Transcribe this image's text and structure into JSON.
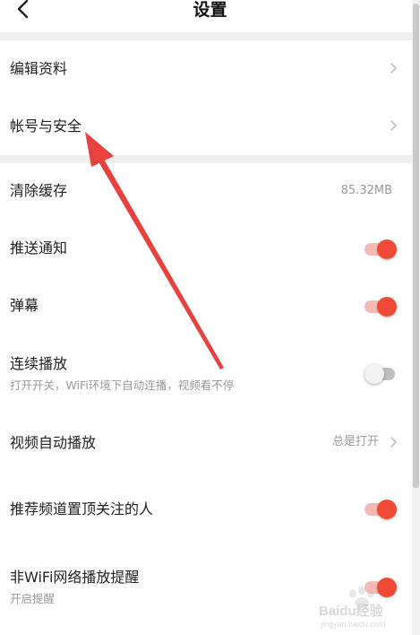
{
  "header": {
    "title": "设置",
    "back_icon": "chevron-left-icon"
  },
  "rows": {
    "edit_profile": {
      "label": "编辑资料"
    },
    "account_security": {
      "label": "帐号与安全"
    },
    "clear_cache": {
      "label": "清除缓存",
      "value": "85.32MB"
    },
    "push_notify": {
      "label": "推送通知",
      "on": true
    },
    "danmaku": {
      "label": "弹幕",
      "on": true
    },
    "continuous_play": {
      "label": "连续播放",
      "sub": "打开开关，WiFi环境下自动连播，视频看不停",
      "on": false
    },
    "video_autoplay": {
      "label": "视频自动播放",
      "value": "总是打开"
    },
    "pin_followed": {
      "label": "推荐频道置顶关注的人",
      "on": true
    },
    "non_wifi_alert": {
      "label": "非WiFi网络播放提醒",
      "sub": "开启提醒",
      "on": true
    }
  },
  "colors": {
    "accent": "#f04a37",
    "toggle_on_track": "#f7b9b4",
    "annotation_arrow": "#e8423f"
  },
  "watermark": {
    "brand": "Baidu经验",
    "url": "jingyan.baidu.com"
  }
}
